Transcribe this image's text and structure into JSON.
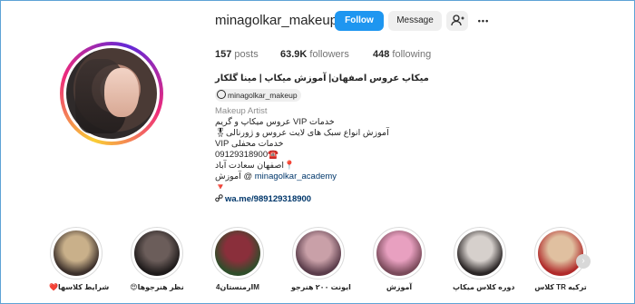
{
  "profile": {
    "username": "minagolkar_makeup",
    "follow_label": "Follow",
    "message_label": "Message",
    "more_glyph": "•••",
    "suggest_icon": "person-add-icon"
  },
  "stats": {
    "posts_value": "157",
    "posts_label": "posts",
    "followers_value": "63.9K",
    "followers_label": "followers",
    "following_value": "448",
    "following_label": "following"
  },
  "bio": {
    "name": "میکاپ عروس اصفهان| آموزش میکاپ | مینا گلکار",
    "threads_handle": "minagolkar_makeup",
    "category": "Makeup Artist",
    "line1": "خدمات VIP عروس میکاپ و گریم",
    "line2": "آموزش انواع سبک های لایت عروس و ژورنالی🎖",
    "line3": "خدمات محفلی VIP",
    "line4": "09129318900☎️",
    "line5": "📍اصفهان سعادت آباد",
    "line6_link": "minagolkar_academy",
    "line6_text": "آموزش @",
    "line7": "🔻",
    "website": "wa.me/989129318900"
  },
  "highlights": [
    {
      "label": "❤️شرایط کلاسها",
      "colors": [
        "#c9b08a",
        "#3b2f2a"
      ]
    },
    {
      "label": "😍نظر هنرجوها",
      "colors": [
        "#6b5d5a",
        "#1e1a1a"
      ]
    },
    {
      "label": "ارمنستان4M",
      "colors": [
        "#8a2f3b",
        "#2f4d2a"
      ]
    },
    {
      "label": "ایونت ۲۰۰ هنرجو",
      "colors": [
        "#c9a0a8",
        "#5a3c4a"
      ]
    },
    {
      "label": "آموزش",
      "colors": [
        "#e8a0c0",
        "#7a4a5a"
      ]
    },
    {
      "label": "دوره کلاس میکاپ",
      "colors": [
        "#d6d0cc",
        "#2a2525"
      ]
    },
    {
      "label": "کلاس TR ترکیه",
      "colors": [
        "#e0c0a0",
        "#b02a2a"
      ]
    }
  ],
  "colors": {
    "follow_button": "#1e96f0",
    "secondary_button": "#efefef",
    "link": "#00376b"
  }
}
